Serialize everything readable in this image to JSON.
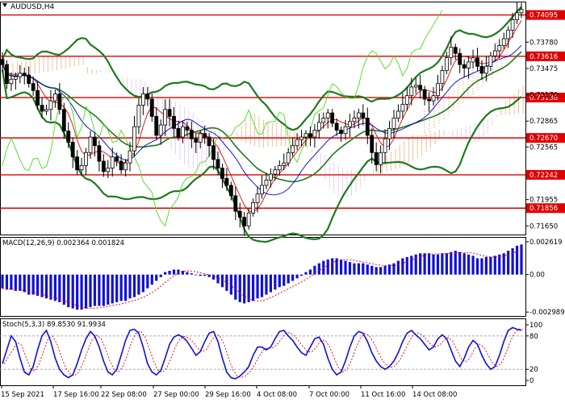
{
  "chart_data": [
    {
      "type": "candlestick",
      "title": "AUDUSD,H4",
      "ylim": [
        0.7155,
        0.7425
      ],
      "y_ticks": [
        0.7378,
        0.73475,
        0.7317,
        0.72865,
        0.72565,
        0.71955,
        0.7165
      ],
      "x_tick_labels": [
        "15 Sep 2021",
        "17 Sep 16:00",
        "22 Sep 08:00",
        "27 Sep 00:00",
        "29 Sep 16:00",
        "4 Oct 08:00",
        "7 Oct 00:00",
        "11 Oct 16:00",
        "14 Oct 08:00"
      ],
      "levels": [
        {
          "label": "0.74095",
          "value": 0.74095
        },
        {
          "label": "0.73616",
          "value": 0.73616
        },
        {
          "label": "0.73138",
          "value": 0.73138
        },
        {
          "label": "0.72670",
          "value": 0.7267
        },
        {
          "label": "0.72242",
          "value": 0.72242
        },
        {
          "label": "0.71856",
          "value": 0.71856
        }
      ],
      "series": [
        {
          "values": [
            0.7352,
            0.733,
            0.7335,
            0.7338,
            0.7342,
            0.734,
            0.733,
            0.7322,
            0.7305,
            0.7298,
            0.73,
            0.731,
            0.7318,
            0.73,
            0.7275,
            0.7262,
            0.7245,
            0.723,
            0.7235,
            0.725,
            0.7268,
            0.7258,
            0.724,
            0.7228,
            0.7232,
            0.7245,
            0.724,
            0.723,
            0.7238,
            0.7252,
            0.728,
            0.7305,
            0.7318,
            0.7312,
            0.7292,
            0.727,
            0.7282,
            0.73,
            0.7292,
            0.7278,
            0.7268,
            0.728,
            0.7276,
            0.7266,
            0.7262,
            0.7272,
            0.7268,
            0.7258,
            0.7242,
            0.7232,
            0.722,
            0.7212,
            0.72,
            0.7182,
            0.7175,
            0.7165,
            0.718,
            0.7192,
            0.7202,
            0.7212,
            0.7218,
            0.7225,
            0.723,
            0.7235,
            0.7238,
            0.725,
            0.7258,
            0.7265,
            0.7268,
            0.7272,
            0.7268,
            0.7276,
            0.7285,
            0.729,
            0.7296,
            0.7284,
            0.7276,
            0.7272,
            0.728,
            0.7286,
            0.729,
            0.7296,
            0.729,
            0.727,
            0.725,
            0.7236,
            0.725,
            0.7266,
            0.7278,
            0.729,
            0.7298,
            0.7306,
            0.7316,
            0.7326,
            0.7328,
            0.7323,
            0.7312,
            0.731,
            0.7316,
            0.733,
            0.7345,
            0.736,
            0.7372,
            0.7365,
            0.7352,
            0.7348,
            0.7355,
            0.736,
            0.735,
            0.7342,
            0.735,
            0.7362,
            0.7368,
            0.7374,
            0.7382,
            0.7392,
            0.7404,
            0.7412,
            0.7416
          ]
        }
      ]
    },
    {
      "type": "bar",
      "title": "MACD(12,26,9) 0.002364 0.001824",
      "ylim": [
        -0.0033,
        0.003
      ],
      "y_ticks": [
        0.002619,
        0.0,
        -0.002989
      ],
      "y_tick_labels": [
        "0.002619",
        "0.00",
        "-0.002989"
      ],
      "series": [
        {
          "values": [
            -0.0011,
            -0.0012,
            -0.0012,
            -0.0013,
            -0.0013,
            -0.0014,
            -0.0016,
            -0.0016,
            -0.0017,
            -0.0018,
            -0.0019,
            -0.002,
            -0.0021,
            -0.0022,
            -0.0024,
            -0.0026,
            -0.0027,
            -0.0028,
            -0.0028,
            -0.0027,
            -0.0026,
            -0.0025,
            -0.0025,
            -0.0025,
            -0.0024,
            -0.0023,
            -0.0022,
            -0.0021,
            -0.0021,
            -0.0019,
            -0.0018,
            -0.0016,
            -0.0014,
            -0.0011,
            -0.0008,
            -0.0005,
            -0.0002,
            0.0002,
            0.0003,
            0.0004,
            0.0004,
            0.0003,
            0.0002,
            0.0001,
            0.0,
            -0.0001,
            -0.0001,
            -0.0002,
            -0.0004,
            -0.0007,
            -0.001,
            -0.0013,
            -0.0016,
            -0.002,
            -0.0022,
            -0.0023,
            -0.0022,
            -0.0021,
            -0.0019,
            -0.0018,
            -0.0016,
            -0.0014,
            -0.0012,
            -0.001,
            -0.0009,
            -0.0007,
            -0.0005,
            -0.0003,
            -0.0001,
            0.0002,
            0.0004,
            0.0007,
            0.0009,
            0.0011,
            0.0012,
            0.0013,
            0.0013,
            0.0012,
            0.0011,
            0.001,
            0.0009,
            0.0009,
            0.0009,
            0.0008,
            0.0007,
            0.0006,
            0.0006,
            0.0007,
            0.0008,
            0.0009,
            0.0011,
            0.0013,
            0.0014,
            0.0015,
            0.0016,
            0.0017,
            0.0017,
            0.0017,
            0.0016,
            0.0016,
            0.0017,
            0.0017,
            0.0018,
            0.0019,
            0.0018,
            0.0017,
            0.0016,
            0.0015,
            0.0013,
            0.0013,
            0.0014,
            0.0014,
            0.0015,
            0.0016,
            0.0017,
            0.0019,
            0.0021,
            0.0023,
            0.0024
          ]
        }
      ]
    },
    {
      "type": "line",
      "title": "Stoch(5,3,3) 89.8530 91.9934",
      "ylim": [
        0,
        100
      ],
      "y_ticks": [
        100,
        80,
        20,
        0
      ],
      "y_tick_labels": [
        "100",
        "80",
        "20",
        "0"
      ],
      "series": [
        {
          "values": [
            30,
            55,
            80,
            70,
            40,
            15,
            10,
            25,
            55,
            80,
            90,
            70,
            40,
            20,
            10,
            5,
            10,
            30,
            55,
            75,
            88,
            80,
            60,
            35,
            15,
            10,
            20,
            45,
            72,
            90,
            92,
            85,
            60,
            30,
            15,
            10,
            18,
            40,
            65,
            78,
            82,
            78,
            70,
            58,
            45,
            52,
            70,
            85,
            88,
            70,
            40,
            15,
            5,
            3,
            8,
            15,
            25,
            45,
            60,
            60,
            55,
            60,
            75,
            88,
            90,
            80,
            72,
            60,
            50,
            45,
            60,
            75,
            78,
            65,
            40,
            20,
            10,
            15,
            35,
            60,
            80,
            88,
            85,
            70,
            50,
            35,
            25,
            20,
            25,
            35,
            50,
            70,
            85,
            90,
            82,
            75,
            65,
            55,
            60,
            75,
            82,
            75,
            55,
            35,
            25,
            40,
            60,
            72,
            65,
            45,
            30,
            20,
            25,
            45,
            70,
            90,
            95,
            92,
            90
          ]
        }
      ]
    }
  ]
}
